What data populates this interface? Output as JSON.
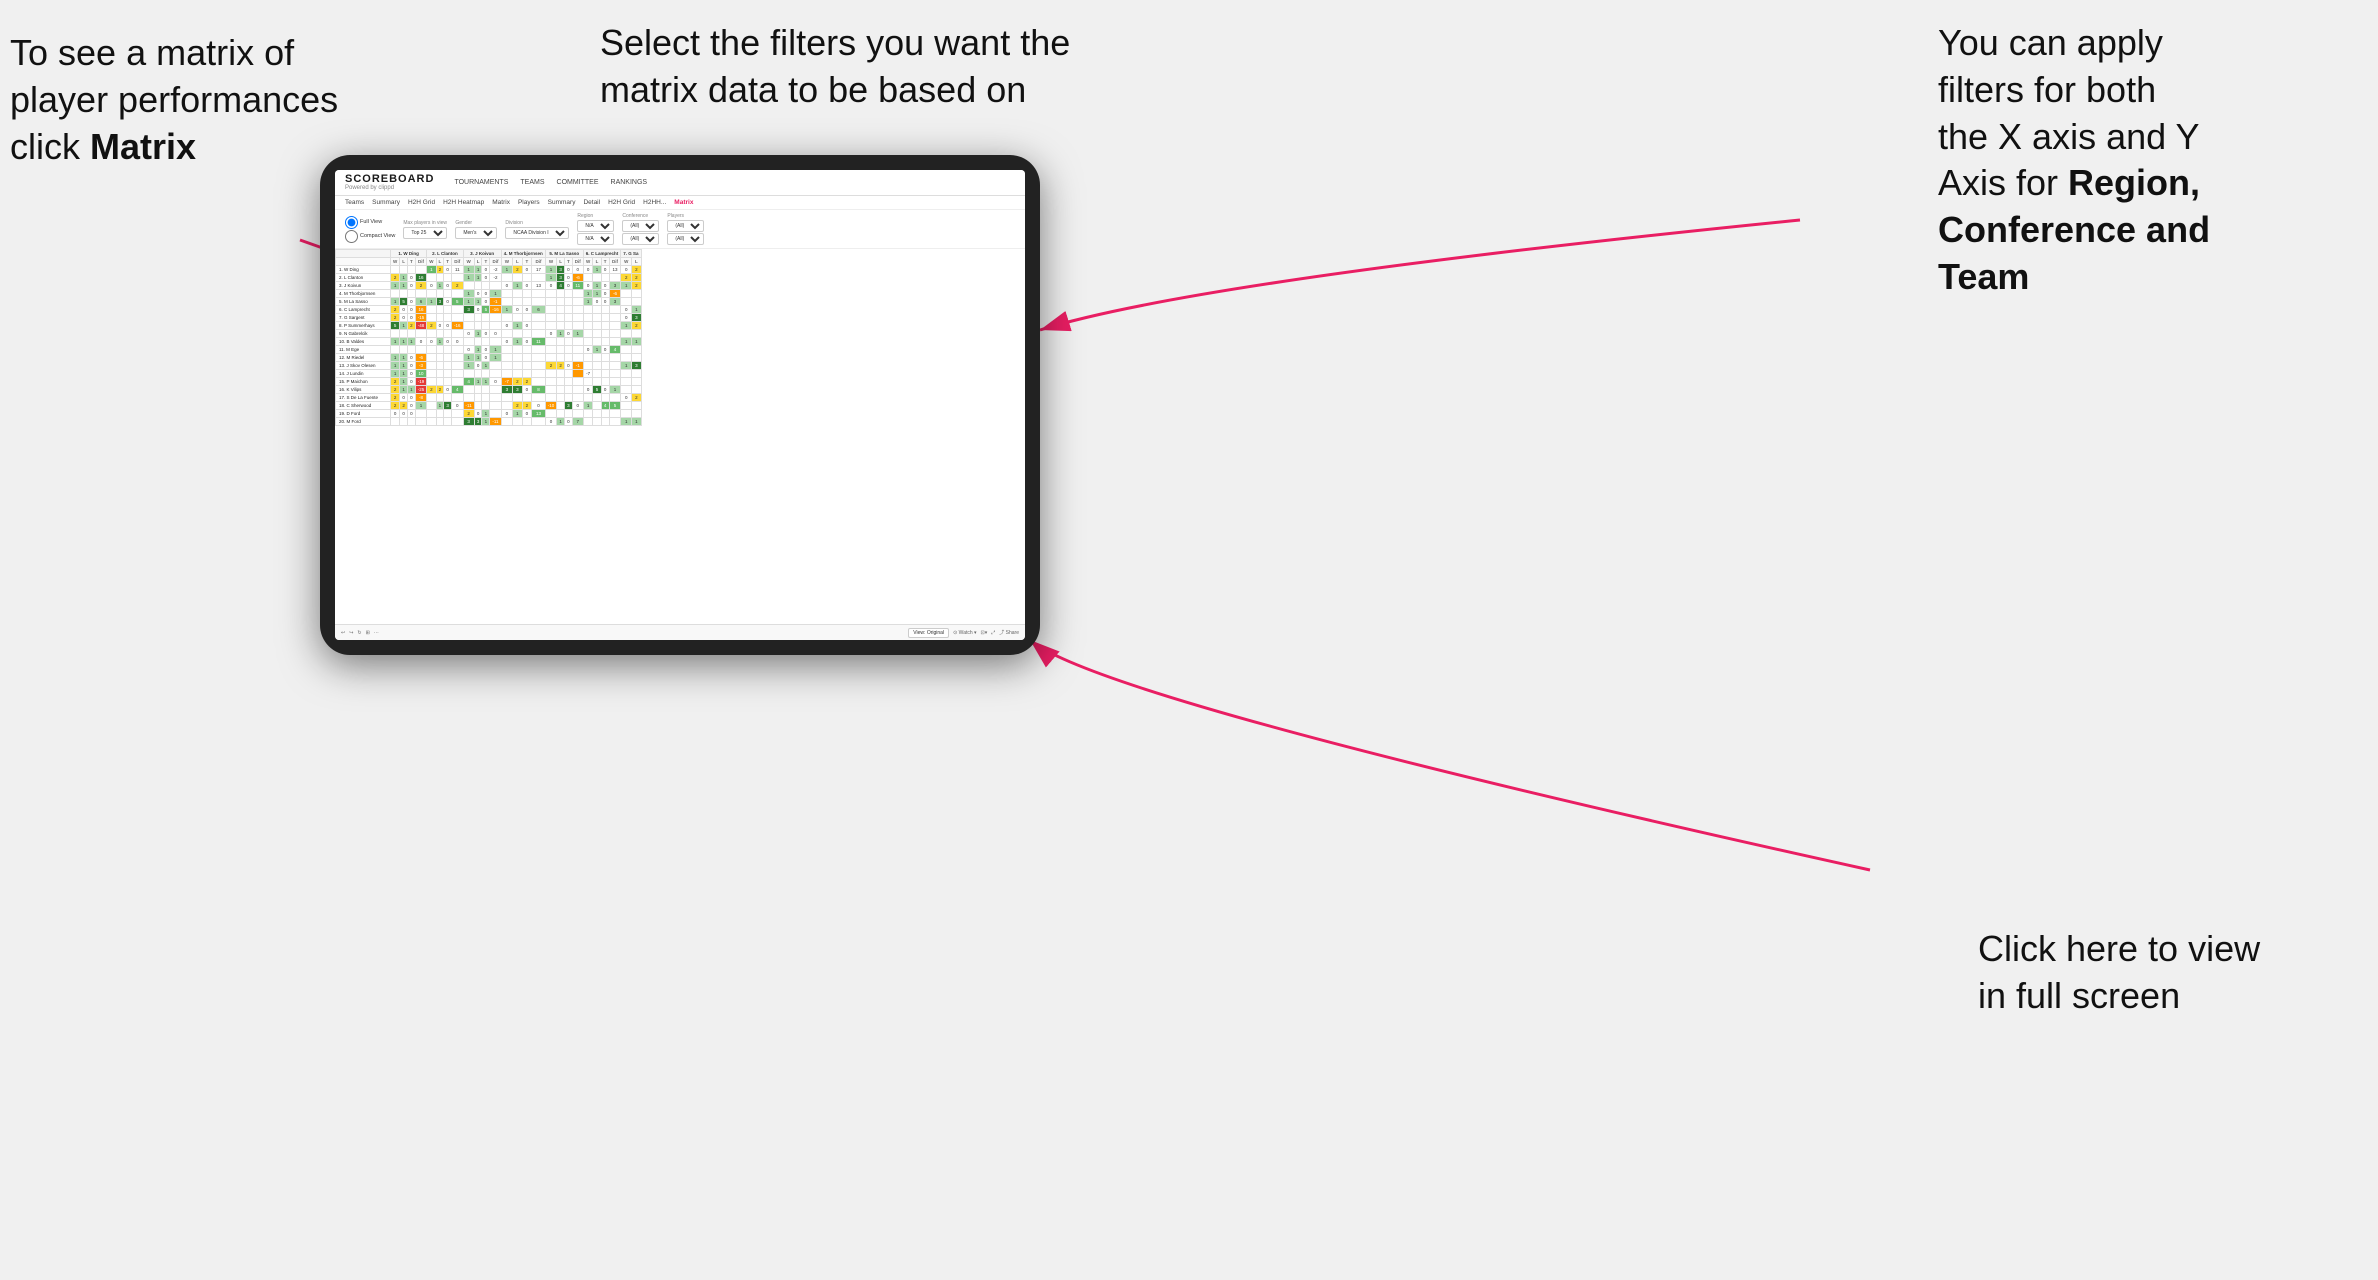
{
  "annotations": {
    "top_left": {
      "line1": "To see a matrix of",
      "line2": "player performances",
      "line3": "click ",
      "line3_bold": "Matrix"
    },
    "top_center": {
      "text": "Select the filters you want the matrix data to be based on"
    },
    "top_right": {
      "line1": "You  can apply",
      "line2": "filters for both",
      "line3": "the X axis and Y",
      "line4": "Axis for ",
      "line4_bold": "Region,",
      "line5_bold": "Conference and",
      "line6_bold": "Team"
    },
    "bottom_right": {
      "line1": "Click here to view",
      "line2": "in full screen"
    }
  },
  "app": {
    "logo_main": "SCOREBOARD",
    "logo_sub": "Powered by clippd",
    "nav": [
      "TOURNAMENTS",
      "TEAMS",
      "COMMITTEE",
      "RANKINGS"
    ],
    "sub_nav": [
      "Teams",
      "Summary",
      "H2H Grid",
      "H2H Heatmap",
      "Matrix",
      "Players",
      "Summary",
      "Detail",
      "H2H Grid",
      "H2HH...",
      "Matrix"
    ],
    "active_tab": "Matrix"
  },
  "filters": {
    "view_options": [
      "Full View",
      "Compact View"
    ],
    "max_players_label": "Max players in view",
    "max_players_value": "Top 25",
    "gender_label": "Gender",
    "gender_value": "Men's",
    "division_label": "Division",
    "division_value": "NCAA Division I",
    "region_label": "Region",
    "region_value": "N/A",
    "conference_label": "Conference",
    "conference_value": "(All)",
    "players_label": "Players",
    "players_value": "(All)"
  },
  "matrix": {
    "col_headers": [
      "1. W Ding",
      "2. L Clanton",
      "3. J Koivun",
      "4. M Thorbjornsen",
      "5. M La Sasso",
      "6. C Lamprecht",
      "7. G Sa"
    ],
    "sub_cols": [
      "W",
      "L",
      "T",
      "Dif"
    ],
    "rows": [
      {
        "name": "1. W Ding",
        "cells": [
          "",
          "",
          "",
          "",
          "1",
          "2",
          "0",
          "11",
          "1",
          "1",
          "0",
          "-2",
          "1",
          "2",
          "0",
          "17",
          "1",
          "3",
          "0",
          "0",
          "0",
          "1",
          "0",
          "13",
          "0",
          "2"
        ]
      },
      {
        "name": "2. L Clanton",
        "cells": [
          "2",
          "1",
          "0",
          "16",
          "",
          "",
          "",
          "",
          "1",
          "1",
          "0",
          "-2",
          "",
          "",
          "",
          "",
          "1",
          "3",
          "0",
          "-6",
          "",
          "",
          "",
          "",
          "2",
          "2"
        ]
      },
      {
        "name": "3. J Koivun",
        "cells": [
          "1",
          "1",
          "0",
          "2",
          "0",
          "1",
          "0",
          "2",
          "",
          "",
          "",
          "",
          "0",
          "1",
          "0",
          "13",
          "0",
          "4",
          "0",
          "11",
          "0",
          "1",
          "0",
          "3",
          "1",
          "2"
        ]
      },
      {
        "name": "4. M Thorbjornsen",
        "cells": [
          "",
          "",
          "",
          "",
          "",
          "",
          "",
          "",
          "1",
          "0",
          "0",
          "1",
          "",
          "",
          "",
          "",
          "",
          "",
          "",
          "",
          "1",
          "1",
          "0",
          "-6",
          ""
        ]
      },
      {
        "name": "5. M La Sasso",
        "cells": [
          "1",
          "5",
          "0",
          "6",
          "1",
          "3",
          "0",
          "5",
          "1",
          "1",
          "0",
          "-1",
          "",
          "",
          "",
          "",
          "",
          "",
          "",
          "",
          "1",
          "0",
          "0",
          "3",
          ""
        ]
      },
      {
        "name": "6. C Lamprecht",
        "cells": [
          "2",
          "0",
          "0",
          "16",
          "",
          "",
          "",
          "",
          "3",
          "0",
          "5",
          "-16",
          "1",
          "0",
          "0",
          "6",
          "",
          "",
          "",
          "",
          "",
          "",
          "",
          "",
          "0",
          "1"
        ]
      },
      {
        "name": "7. G Sargent",
        "cells": [
          "2",
          "0",
          "0",
          "-15",
          "",
          "",
          "",
          "",
          "",
          "",
          "",
          "",
          "",
          "",
          "",
          "",
          "",
          "",
          "",
          "",
          "",
          "",
          "",
          "",
          "0",
          "3"
        ]
      },
      {
        "name": "8. P Summerhays",
        "cells": [
          "5",
          "1",
          "2",
          "-48",
          "2",
          "0",
          "0",
          "-16",
          "",
          "",
          "",
          "",
          "0",
          "1",
          "0",
          "",
          "",
          "",
          "",
          "",
          "",
          "",
          "",
          "",
          "1",
          "2"
        ]
      },
      {
        "name": "9. N Gabrelcik",
        "cells": [
          "",
          "",
          "",
          "",
          "",
          "",
          "",
          "",
          "0",
          "1",
          "0",
          "0",
          "",
          "",
          "",
          "",
          "0",
          "1",
          "0",
          "1",
          "",
          "",
          "",
          "",
          "",
          ""
        ]
      },
      {
        "name": "10. B Valdes",
        "cells": [
          "1",
          "1",
          "1",
          "0",
          "0",
          "1",
          "0",
          "0",
          "",
          "",
          "",
          "",
          "0",
          "1",
          "0",
          "11",
          "",
          "",
          "",
          "",
          "",
          "",
          "",
          "",
          "1",
          "1"
        ]
      },
      {
        "name": "11. M Ege",
        "cells": [
          "",
          "",
          "",
          "",
          "",
          "",
          "",
          "",
          "0",
          "1",
          "0",
          "1",
          "",
          "",
          "",
          "",
          "",
          "",
          "",
          "",
          "0",
          "1",
          "0",
          "4",
          ""
        ]
      },
      {
        "name": "12. M Riedel",
        "cells": [
          "1",
          "1",
          "0",
          "-6",
          "",
          "",
          "",
          "",
          "1",
          "1",
          "0",
          "1",
          "",
          "",
          "",
          "",
          "",
          "",
          "",
          "",
          "",
          "",
          "",
          "",
          ""
        ]
      },
      {
        "name": "13. J Skov Olesen",
        "cells": [
          "1",
          "1",
          "0",
          "-3",
          "",
          "",
          "",
          "",
          "1",
          "0",
          "1",
          "",
          "",
          "",
          "",
          "",
          "2",
          "2",
          "0",
          "-1",
          "",
          "",
          "",
          "",
          "1",
          "3"
        ]
      },
      {
        "name": "14. J Lundin",
        "cells": [
          "1",
          "1",
          "0",
          "10",
          "",
          "",
          "",
          "",
          "",
          "",
          "",
          "",
          "",
          "",
          "",
          "",
          "",
          "",
          "",
          "",
          "-7",
          "",
          "",
          "",
          ""
        ]
      },
      {
        "name": "15. P Maichon",
        "cells": [
          "2",
          "1",
          "0",
          "-19",
          "",
          "",
          "",
          "",
          "4",
          "1",
          "1",
          "0",
          "-7",
          "2",
          "2"
        ]
      },
      {
        "name": "16. K Vilips",
        "cells": [
          "2",
          "1",
          "1",
          "-25",
          "2",
          "2",
          "0",
          "4",
          "",
          "",
          "",
          "",
          "3",
          "3",
          "0",
          "8",
          "",
          "",
          "",
          "",
          "0",
          "5",
          "0",
          "1"
        ]
      },
      {
        "name": "17. S De La Fuente",
        "cells": [
          "2",
          "0",
          "0",
          "-8",
          "",
          "",
          "",
          "",
          "",
          "",
          "",
          "",
          "",
          "",
          "",
          "",
          "",
          "",
          "",
          "",
          "",
          "",
          "",
          "",
          "0",
          "2"
        ]
      },
      {
        "name": "18. C Sherwood",
        "cells": [
          "2",
          "2",
          "0",
          "1",
          "",
          "1",
          "3",
          "0",
          "-11",
          "",
          "",
          "",
          "",
          "2",
          "2",
          "0",
          "-10",
          "",
          "3",
          "0",
          "1",
          "",
          "4",
          "5"
        ]
      },
      {
        "name": "19. D Ford",
        "cells": [
          "0",
          "0",
          "0",
          "",
          "",
          "",
          "",
          "",
          "2",
          "0",
          "1",
          "",
          "0",
          "1",
          "0",
          "13",
          "",
          "",
          "",
          "",
          "",
          "",
          "",
          "",
          ""
        ]
      },
      {
        "name": "20. M Ford",
        "cells": [
          "",
          "",
          "",
          "",
          "",
          "",
          "",
          "",
          "3",
          "3",
          "1",
          "-11",
          "",
          "",
          "",
          "",
          "0",
          "1",
          "0",
          "7",
          "",
          "",
          "",
          "",
          "1",
          "1"
        ]
      }
    ]
  },
  "toolbar": {
    "view_original": "View: Original",
    "watch": "Watch",
    "share": "Share"
  },
  "colors": {
    "arrow": "#e91e63",
    "active_tab": "#e91e63"
  }
}
